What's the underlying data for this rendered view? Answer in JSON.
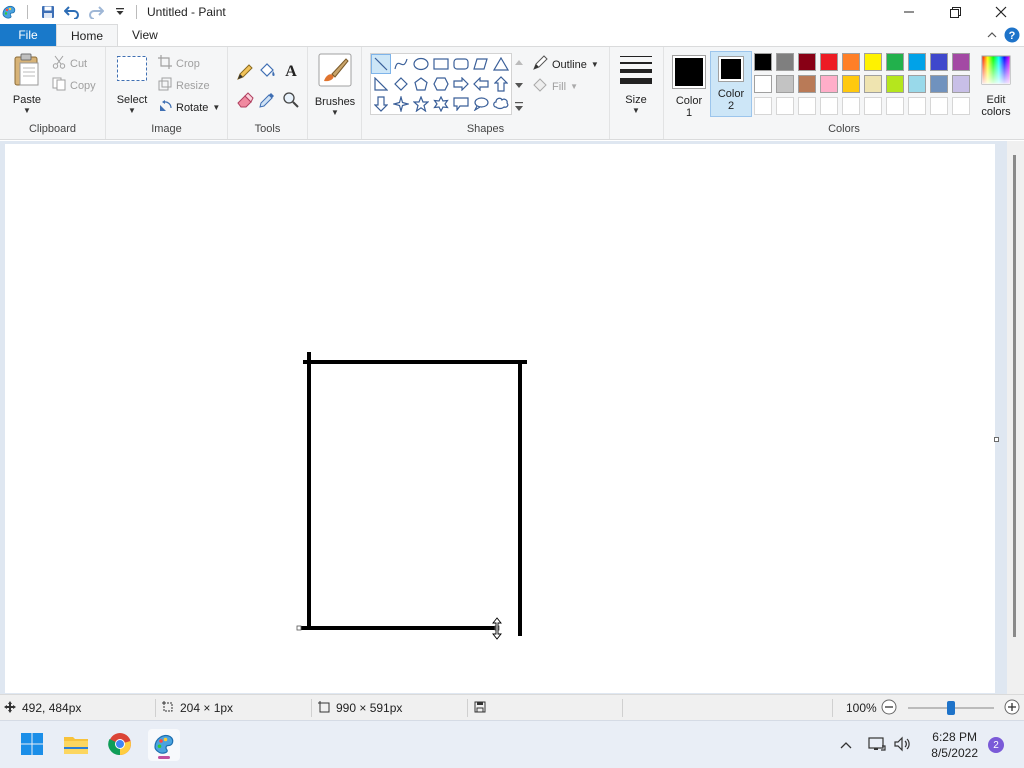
{
  "window": {
    "title": "Untitled - Paint"
  },
  "tabs": {
    "file": "File",
    "home": "Home",
    "view": "View"
  },
  "clipboard": {
    "paste": "Paste",
    "cut": "Cut",
    "copy": "Copy",
    "label": "Clipboard"
  },
  "image": {
    "select": "Select",
    "crop": "Crop",
    "resize": "Resize",
    "rotate": "Rotate",
    "label": "Image"
  },
  "tools": {
    "label": "Tools"
  },
  "brushes": {
    "label": "Brushes"
  },
  "shapes": {
    "outline": "Outline",
    "fill": "Fill",
    "label": "Shapes",
    "selected": "line"
  },
  "size": {
    "label": "Size"
  },
  "colors": {
    "color1_line1": "Color",
    "color1_line2": "1",
    "color2_line1": "Color",
    "color2_line2": "2",
    "color1_value": "#000000",
    "color2_value": "#000000",
    "edit_line1": "Edit",
    "edit_line2": "colors",
    "label": "Colors",
    "palette_row1": [
      "#000000",
      "#7f7f7f",
      "#880015",
      "#ed1c24",
      "#ff7f27",
      "#fff200",
      "#22b14c",
      "#00a2e8",
      "#3f48cc",
      "#a349a4"
    ],
    "palette_row2": [
      "#ffffff",
      "#c3c3c3",
      "#b97a57",
      "#ffaec9",
      "#ffc90e",
      "#efe4b0",
      "#b5e61d",
      "#99d9ea",
      "#7092be",
      "#c8bfe7"
    ]
  },
  "status": {
    "cursor_pos": "492, 484px",
    "selection_size": "204 × 1px",
    "image_size": "990 × 591px",
    "zoom": "100%",
    "zoom_level_fraction": 0.5
  },
  "taskbar": {
    "time": "6:28 PM",
    "date": "8/5/2022",
    "notifications": "2"
  }
}
